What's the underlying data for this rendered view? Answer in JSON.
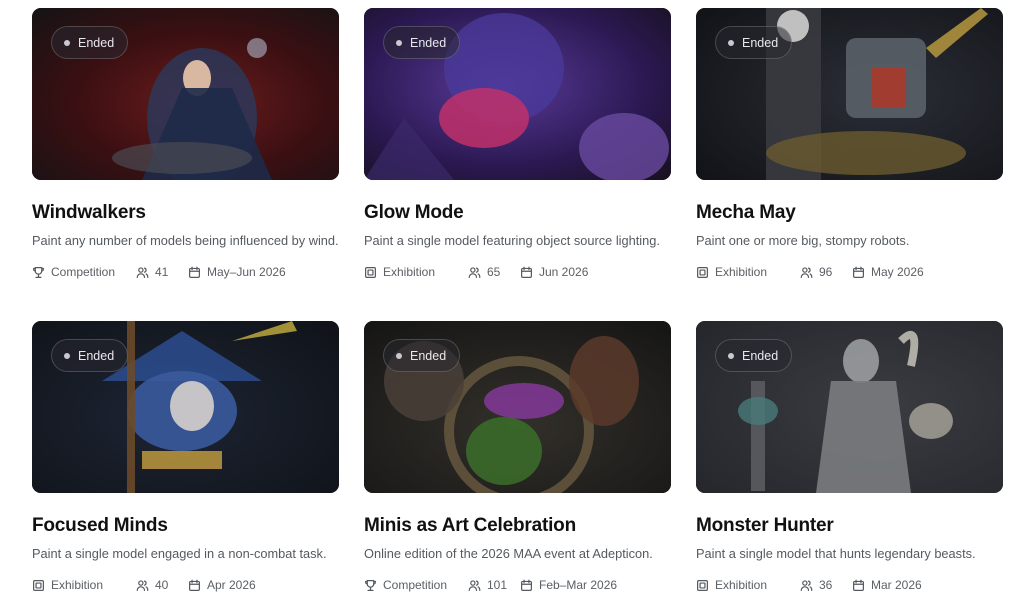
{
  "cards": [
    {
      "status": "Ended",
      "title": "Windwalkers",
      "description": "Paint any number of models being influenced by wind.",
      "type": "Competition",
      "type_icon": "trophy-icon",
      "participants": "41",
      "dates": "May–Jun 2026",
      "colors": [
        "#3a0f12",
        "#1a1414",
        "#6b1c1c"
      ]
    },
    {
      "status": "Ended",
      "title": "Glow Mode",
      "description": "Paint a single model featuring object source lighting.",
      "type": "Exhibition",
      "type_icon": "frame-icon",
      "participants": "65",
      "dates": "Jun 2026",
      "colors": [
        "#2a1850",
        "#1a1020",
        "#c0306a"
      ]
    },
    {
      "status": "Ended",
      "title": "Mecha May",
      "description": "Paint one or more big, stompy robots.",
      "type": "Exhibition",
      "type_icon": "frame-icon",
      "participants": "96",
      "dates": "May 2026",
      "colors": [
        "#121418",
        "#2b2e36",
        "#a83a2a"
      ]
    },
    {
      "status": "Ended",
      "title": "Focused Minds",
      "description": "Paint a single model engaged in a non-combat task.",
      "type": "Exhibition",
      "type_icon": "frame-icon",
      "participants": "40",
      "dates": "Apr 2026",
      "colors": [
        "#141820",
        "#1d2433",
        "#3a5a9c"
      ]
    },
    {
      "status": "Ended",
      "title": "Minis as Art Celebration",
      "description": "Online edition of the 2026 MAA event at Adepticon.",
      "type": "Competition",
      "type_icon": "trophy-icon",
      "participants": "101",
      "dates": "Feb–Mar 2026",
      "colors": [
        "#1e1e1e",
        "#33302a",
        "#3a6a2a"
      ]
    },
    {
      "status": "Ended",
      "title": "Monster Hunter",
      "description": "Paint a single model that hunts legendary beasts.",
      "type": "Exhibition",
      "type_icon": "frame-icon",
      "participants": "36",
      "dates": "Mar 2026",
      "colors": [
        "#2e3036",
        "#24262b",
        "#7a7c80"
      ]
    }
  ]
}
